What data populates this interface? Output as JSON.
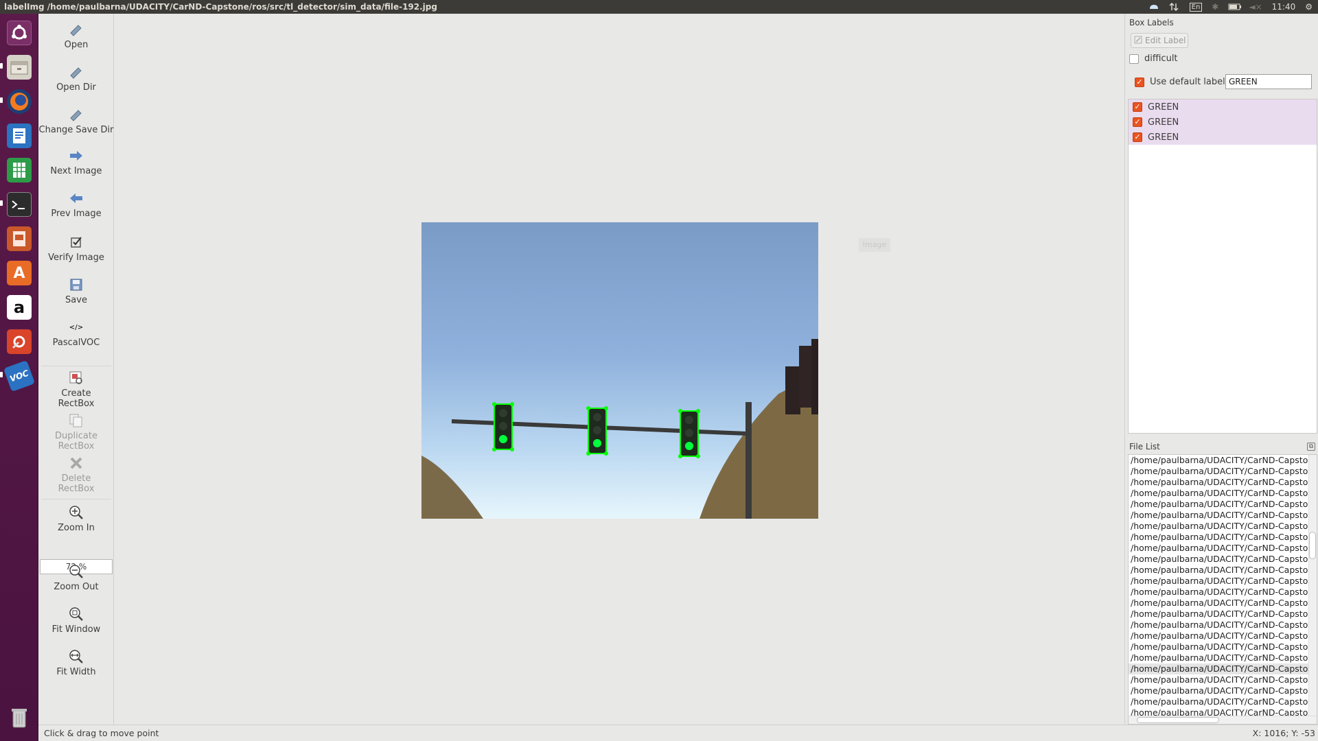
{
  "window": {
    "title": "labelImg /home/paulbarna/UDACITY/CarND-Capstone/ros/src/tl_detector/sim_data/file-192.jpg"
  },
  "system_tray": {
    "keyboard_layout": "En",
    "clock": "11:40"
  },
  "launcher": {
    "items": [
      {
        "icon": "ubuntu-dash-icon"
      },
      {
        "icon": "files-icon"
      },
      {
        "icon": "firefox-icon"
      },
      {
        "icon": "libreoffice-writer-icon"
      },
      {
        "icon": "libreoffice-calc-icon"
      },
      {
        "icon": "terminal-icon"
      },
      {
        "icon": "libreoffice-impress-icon"
      },
      {
        "icon": "software-center-icon"
      },
      {
        "icon": "amazon-icon"
      },
      {
        "icon": "system-settings-icon"
      },
      {
        "icon": "labelimg-voc-icon",
        "text": "VOC"
      },
      {
        "icon": "trash-icon"
      }
    ]
  },
  "toolbar": {
    "open": "Open",
    "open_dir": "Open Dir",
    "change_save_dir": "Change Save Dir",
    "next_image": "Next Image",
    "prev_image": "Prev Image",
    "verify_image": "Verify Image",
    "save": "Save",
    "format": "PascalVOC",
    "format_icon_text": "</>",
    "create_rectbox": "Create\nRectBox",
    "duplicate_rectbox": "Duplicate\nRectBox",
    "delete_rectbox": "Delete\nRectBox",
    "zoom_in": "Zoom In",
    "zoom_value": "72 %",
    "zoom_out": "Zoom Out",
    "fit_window": "Fit Window",
    "fit_width": "Fit Width"
  },
  "canvas": {
    "tooltip": "Image",
    "boxes": [
      {
        "label": "GREEN",
        "color": "#00ff00"
      },
      {
        "label": "GREEN",
        "color": "#00ff00"
      },
      {
        "label": "GREEN",
        "color": "#00ff00"
      }
    ]
  },
  "box_labels": {
    "title": "Box Labels",
    "edit_label": "Edit Label",
    "difficult": "difficult",
    "difficult_checked": false,
    "use_default_label": "Use default label",
    "use_default_checked": true,
    "default_label_value": "GREEN",
    "labels": [
      {
        "text": "GREEN",
        "checked": true
      },
      {
        "text": "GREEN",
        "checked": true
      },
      {
        "text": "GREEN",
        "checked": true
      }
    ]
  },
  "file_list": {
    "title": "File List",
    "selected_index": 19,
    "items": [
      "/home/paulbarna/UDACITY/CarND-Capstone",
      "/home/paulbarna/UDACITY/CarND-Capstone",
      "/home/paulbarna/UDACITY/CarND-Capstone",
      "/home/paulbarna/UDACITY/CarND-Capstone",
      "/home/paulbarna/UDACITY/CarND-Capstone",
      "/home/paulbarna/UDACITY/CarND-Capstone",
      "/home/paulbarna/UDACITY/CarND-Capstone",
      "/home/paulbarna/UDACITY/CarND-Capstone",
      "/home/paulbarna/UDACITY/CarND-Capstone",
      "/home/paulbarna/UDACITY/CarND-Capstone",
      "/home/paulbarna/UDACITY/CarND-Capstone",
      "/home/paulbarna/UDACITY/CarND-Capstone",
      "/home/paulbarna/UDACITY/CarND-Capstone",
      "/home/paulbarna/UDACITY/CarND-Capstone",
      "/home/paulbarna/UDACITY/CarND-Capstone",
      "/home/paulbarna/UDACITY/CarND-Capstone",
      "/home/paulbarna/UDACITY/CarND-Capstone",
      "/home/paulbarna/UDACITY/CarND-Capstone",
      "/home/paulbarna/UDACITY/CarND-Capstone",
      "/home/paulbarna/UDACITY/CarND-Capstone",
      "/home/paulbarna/UDACITY/CarND-Capstone",
      "/home/paulbarna/UDACITY/CarND-Capstone",
      "/home/paulbarna/UDACITY/CarND-Capstone",
      "/home/paulbarna/UDACITY/CarND-Capstone"
    ]
  },
  "status": {
    "message": "Click & drag to move point",
    "coords": "X: 1016; Y: -53"
  }
}
